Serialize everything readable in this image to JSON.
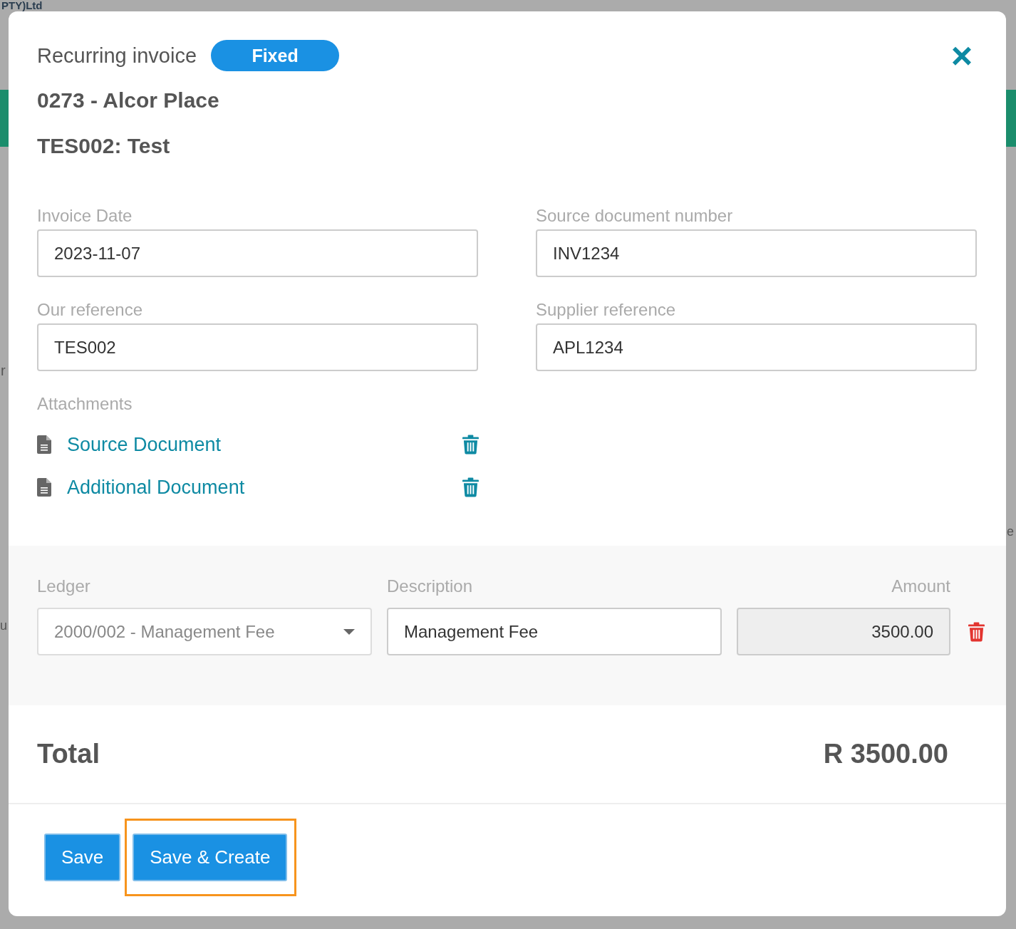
{
  "background_fragments": [
    "PTY)Ltd",
    "r",
    "u",
    "e"
  ],
  "modal": {
    "title": "Recurring invoice",
    "badge": "Fixed",
    "close": "×",
    "property": "0273 - Alcor Place",
    "tenant": "TES002: Test"
  },
  "fields": [
    {
      "label": "Invoice Date",
      "value": "2023-11-07"
    },
    {
      "label": "Source document number",
      "value": "INV1234"
    },
    {
      "label": "Our reference",
      "value": "TES002"
    },
    {
      "label": "Supplier reference",
      "value": "APL1234"
    }
  ],
  "attachments": {
    "label": "Attachments",
    "items": [
      {
        "name": "Source Document"
      },
      {
        "name": "Additional Document"
      }
    ]
  },
  "line_items": {
    "columns": [
      "Ledger",
      "Description",
      "Amount"
    ],
    "rows": [
      {
        "ledger": "2000/002 - Management Fee",
        "description": "Management Fee",
        "amount": "3500.00"
      }
    ]
  },
  "total": {
    "label": "Total",
    "value": "R 3500.00"
  },
  "buttons": [
    {
      "label": "Save",
      "highlighted": false
    },
    {
      "label": "Save & Create",
      "highlighted": true
    }
  ]
}
